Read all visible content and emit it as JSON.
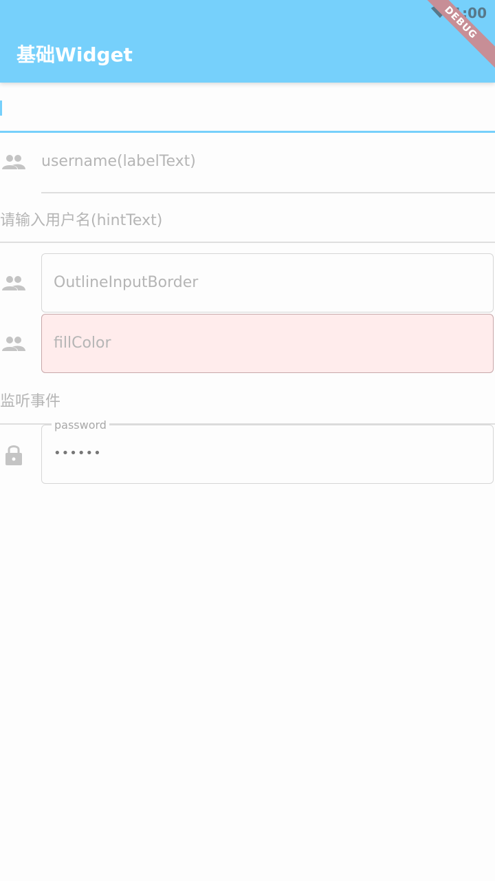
{
  "status": {
    "time": "1:00",
    "wifi_icon": "wifi-icon"
  },
  "appbar": {
    "title": "基础Widget",
    "debug_label": "DEBUG"
  },
  "fields": {
    "empty_input_value": "",
    "username_label": "username(labelText)",
    "hint_text": "请输入用户名(hintText)",
    "outline_label": "OutlineInputBorder",
    "fill_label": "fillColor",
    "listen_text": "监听事件",
    "password_label": "password",
    "password_value": "••••••"
  },
  "colors": {
    "accent": "#76d0fb",
    "fill": "#ffecec",
    "hint": "#b5b5b5"
  },
  "icons": {
    "people": "people-icon",
    "lock": "lock-icon"
  }
}
